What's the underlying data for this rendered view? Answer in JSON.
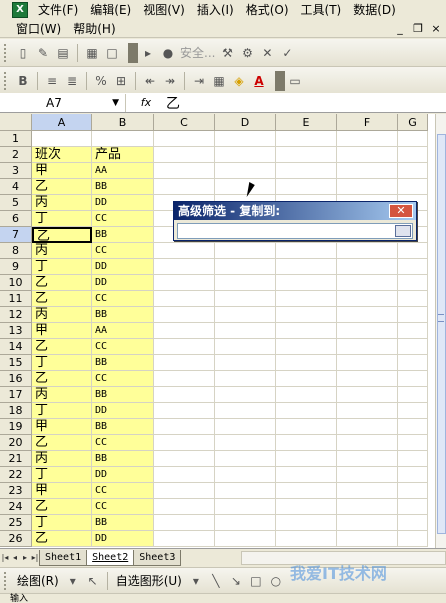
{
  "menu": {
    "row1": [
      "文件(F)",
      "编辑(E)",
      "视图(V)",
      "插入(I)",
      "格式(O)",
      "工具(T)",
      "数据(D)"
    ],
    "row2": [
      "窗口(W)",
      "帮助(H)"
    ]
  },
  "toolbar": {
    "security_label": "安全..."
  },
  "formula": {
    "name_box": "A7",
    "fx_label": "fx",
    "value": "乙"
  },
  "sheet": {
    "columns": [
      "A",
      "B",
      "C",
      "D",
      "E",
      "F",
      "G"
    ],
    "rows": [
      {
        "n": "1",
        "a": "",
        "b": ""
      },
      {
        "n": "2",
        "a": "班次",
        "b": "产品"
      },
      {
        "n": "3",
        "a": "甲",
        "b": "AA"
      },
      {
        "n": "4",
        "a": "乙",
        "b": "BB"
      },
      {
        "n": "5",
        "a": "丙",
        "b": "DD"
      },
      {
        "n": "6",
        "a": "丁",
        "b": "CC"
      },
      {
        "n": "7",
        "a": "乙",
        "b": "BB"
      },
      {
        "n": "8",
        "a": "丙",
        "b": "CC"
      },
      {
        "n": "9",
        "a": "丁",
        "b": "DD"
      },
      {
        "n": "10",
        "a": "乙",
        "b": "DD"
      },
      {
        "n": "11",
        "a": "乙",
        "b": "CC"
      },
      {
        "n": "12",
        "a": "丙",
        "b": "BB"
      },
      {
        "n": "13",
        "a": "甲",
        "b": "AA"
      },
      {
        "n": "14",
        "a": "乙",
        "b": "CC"
      },
      {
        "n": "15",
        "a": "丁",
        "b": "BB"
      },
      {
        "n": "16",
        "a": "乙",
        "b": "CC"
      },
      {
        "n": "17",
        "a": "丙",
        "b": "BB"
      },
      {
        "n": "18",
        "a": "丁",
        "b": "DD"
      },
      {
        "n": "19",
        "a": "甲",
        "b": "BB"
      },
      {
        "n": "20",
        "a": "乙",
        "b": "CC"
      },
      {
        "n": "21",
        "a": "丙",
        "b": "BB"
      },
      {
        "n": "22",
        "a": "丁",
        "b": "DD"
      },
      {
        "n": "23",
        "a": "甲",
        "b": "CC"
      },
      {
        "n": "24",
        "a": "乙",
        "b": "CC"
      },
      {
        "n": "25",
        "a": "丁",
        "b": "BB"
      },
      {
        "n": "26",
        "a": "乙",
        "b": "DD"
      }
    ],
    "tabs": [
      "Sheet1",
      "Sheet2",
      "Sheet3"
    ],
    "active_tab": "Sheet2"
  },
  "dialog": {
    "title": "高级筛选 - 复制到:",
    "close_label": "✕"
  },
  "drawbar": {
    "draw_label": "绘图(R)",
    "autoshape_label": "自选图形(U)"
  },
  "status": {
    "text": "输入"
  },
  "watermark": "我爱IT技术网"
}
